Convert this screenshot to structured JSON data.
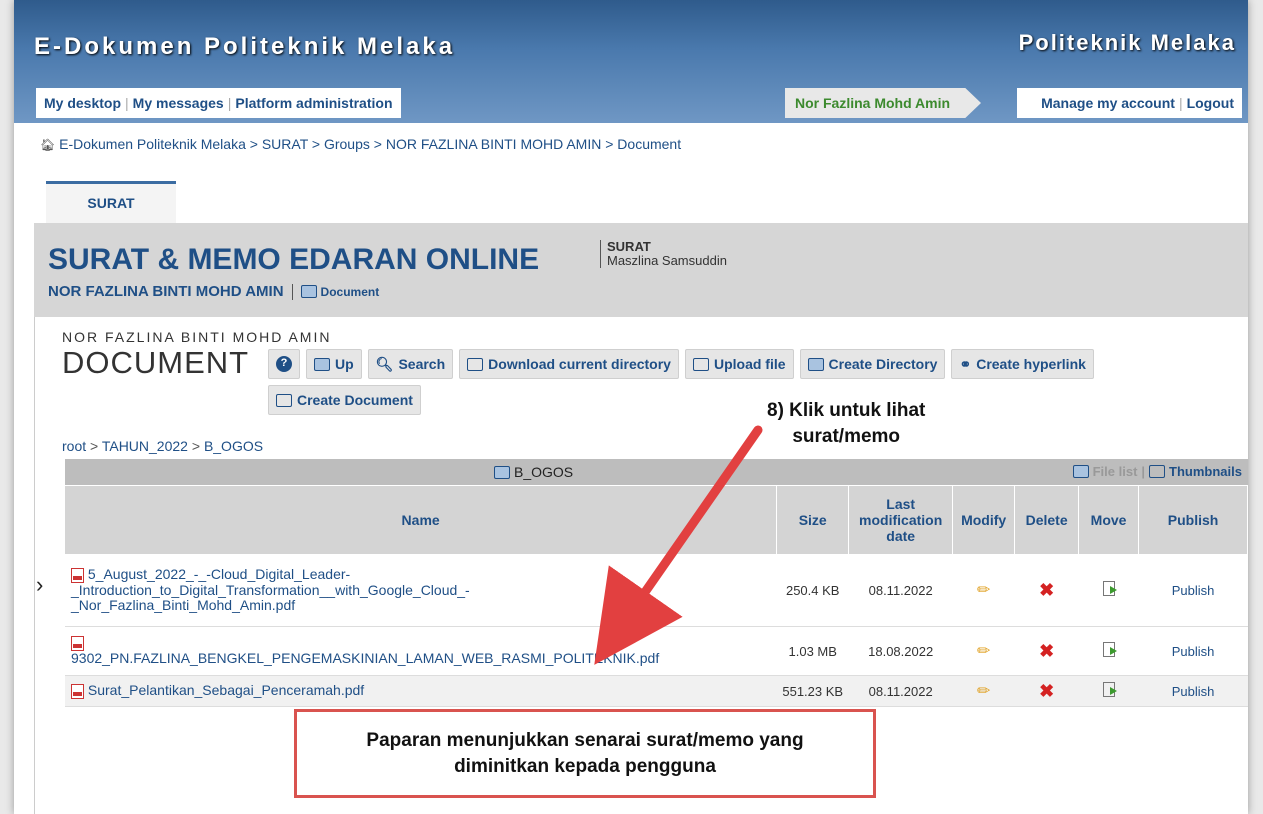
{
  "header": {
    "site_title": "E-Dokumen Politeknik Melaka",
    "institution": "Politeknik Melaka"
  },
  "nav": {
    "left": [
      "My desktop",
      "My messages",
      "Platform administration"
    ],
    "user": "Nor Fazlina Mohd Amin",
    "right": [
      "Manage my account",
      "Logout"
    ]
  },
  "breadcrumb": [
    "E-Dokumen Politeknik Melaka",
    "SURAT",
    "Groups",
    "NOR FAZLINA BINTI MOHD AMIN",
    "Document"
  ],
  "course_tab": "SURAT",
  "group": {
    "title": "SURAT & MEMO EDARAN ONLINE",
    "code": "SURAT",
    "teacher": "Maszlina Samsuddin",
    "subtitle": "NOR FAZLINA BINTI MOHD AMIN",
    "doc_link": "Document"
  },
  "tool": {
    "owner": "NOR FAZLINA BINTI MOHD AMIN",
    "title": "DOCUMENT",
    "buttons": {
      "up": "Up",
      "search": "Search",
      "download": "Download current directory",
      "upload": "Upload file",
      "create_dir": "Create Directory",
      "create_link": "Create hyperlink",
      "create_doc": "Create Document"
    }
  },
  "path": {
    "root": "root",
    "p1": "TAHUN_2022",
    "p2": "B_OGOS"
  },
  "listing": {
    "dir_name": "B_OGOS",
    "file_list": "File list",
    "thumbnails": "Thumbnails",
    "columns": [
      "Name",
      "Size",
      "Last modification date",
      "Modify",
      "Delete",
      "Move",
      "Publish"
    ],
    "rows": [
      {
        "name": "5_August_2022_-_-Cloud_Digital_Leader-_Introduction_to_Digital_Transformation__with_Google_Cloud_-_Nor_Fazlina_Binti_Mohd_Amin.pdf",
        "name_l1": "5_August_2022_-_-Cloud_Digital_Leader-",
        "name_l2": "_Introduction_to_Digital_Transformation__with_Google_Cloud_-",
        "name_l3": "_Nor_Fazlina_Binti_Mohd_Amin.pdf",
        "size": "250.4 KB",
        "date": "08.11.2022",
        "publish": "Publish"
      },
      {
        "name": "9302_PN.FAZLINA_BENGKEL_PENGEMASKINIAN_LAMAN_WEB_RASMI_POLITEKNIK.pdf",
        "size": "1.03 MB",
        "date": "18.08.2022",
        "publish": "Publish"
      },
      {
        "name": "Surat_Pelantikan_Sebagai_Penceramah.pdf",
        "size": "551.23 KB",
        "date": "08.11.2022",
        "publish": "Publish"
      }
    ]
  },
  "annotations": {
    "step_l1": "8) Klik untuk lihat",
    "step_l2": "surat/memo",
    "caption_l1": "Paparan menunjukkan senarai surat/memo yang",
    "caption_l2": "diminitkan kepada pengguna"
  },
  "colors": {
    "link": "#1f4f86",
    "header": "#3b6ca2",
    "user_green": "#3c8a2e",
    "annotation_red": "#d9534f"
  }
}
